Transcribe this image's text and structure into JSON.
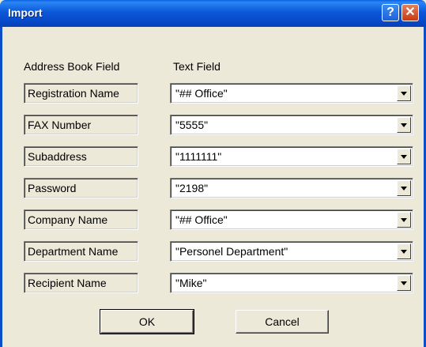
{
  "window": {
    "title": "Import",
    "help_label": "?",
    "close_label": "✕"
  },
  "columns": {
    "address_book": "Address Book Field",
    "text_field": "Text Field"
  },
  "rows": [
    {
      "label": "Registration Name",
      "value": "\"## Office\""
    },
    {
      "label": "FAX Number",
      "value": "\"5555\""
    },
    {
      "label": "Subaddress",
      "value": "\"1111111\""
    },
    {
      "label": "Password",
      "value": "\"2198\""
    },
    {
      "label": "Company Name",
      "value": "\"## Office\""
    },
    {
      "label": "Department Name",
      "value": "\"Personel Department\""
    },
    {
      "label": "Recipient Name",
      "value": "\"Mike\""
    }
  ],
  "buttons": {
    "ok": "OK",
    "cancel": "Cancel"
  },
  "icons": {
    "help": "help-icon",
    "close": "close-icon",
    "dropdown": "chevron-down-icon"
  }
}
